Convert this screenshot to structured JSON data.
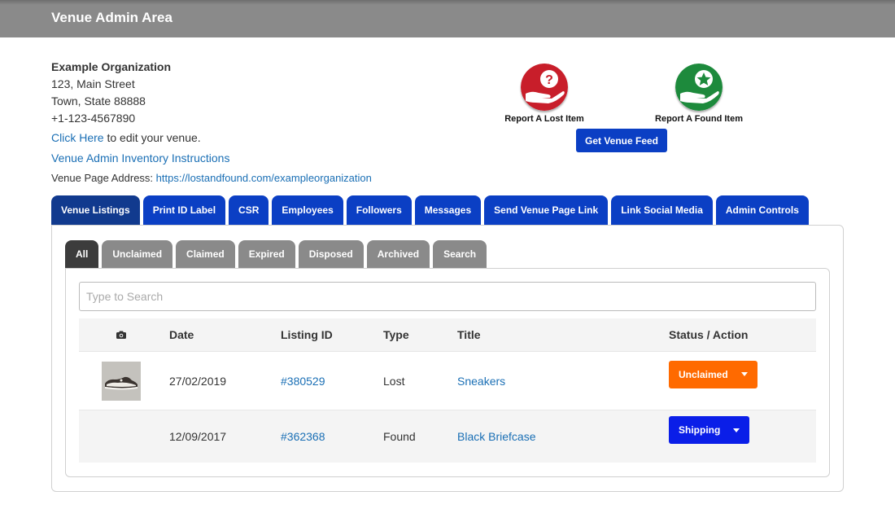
{
  "header": {
    "title": "Venue Admin Area"
  },
  "venue": {
    "name": "Example Organization",
    "address_line1": "123, Main Street",
    "address_line2": "Town, State 88888",
    "phone": "+1-123-4567890",
    "edit_link": "Click Here",
    "edit_suffix": " to edit your venue.",
    "instructions_link": "Venue Admin Inventory Instructions",
    "page_address_label": "Venue Page Address: ",
    "page_address_url": "https://lostandfound.com/exampleorganization"
  },
  "actions": {
    "report_lost": "Report A Lost Item",
    "report_found": "Report A Found Item",
    "venue_feed": "Get Venue Feed"
  },
  "main_tabs": [
    {
      "label": "Venue Listings",
      "active": true
    },
    {
      "label": "Print ID Label"
    },
    {
      "label": "CSR"
    },
    {
      "label": "Employees"
    },
    {
      "label": "Followers"
    },
    {
      "label": "Messages"
    },
    {
      "label": "Send Venue Page Link"
    },
    {
      "label": "Link Social Media"
    },
    {
      "label": "Admin Controls"
    }
  ],
  "sub_tabs": [
    {
      "label": "All",
      "active": true
    },
    {
      "label": "Unclaimed"
    },
    {
      "label": "Claimed"
    },
    {
      "label": "Expired"
    },
    {
      "label": "Disposed"
    },
    {
      "label": "Archived"
    },
    {
      "label": "Search"
    }
  ],
  "search": {
    "placeholder": "Type to Search",
    "value": ""
  },
  "table": {
    "columns": {
      "photo": "camera-icon",
      "date": "Date",
      "listing_id": "Listing ID",
      "type": "Type",
      "title": "Title",
      "status": "Status / Action"
    },
    "rows": [
      {
        "date": "27/02/2019",
        "listing_id": "#380529",
        "type": "Lost",
        "title": "Sneakers",
        "status": "Unclaimed",
        "status_color": "#ff6a00",
        "has_photo": true
      },
      {
        "date": "12/09/2017",
        "listing_id": "#362368",
        "type": "Found",
        "title": "Black Briefcase",
        "status": "Shipping",
        "status_color": "#0a1ee8",
        "has_photo": false
      }
    ]
  },
  "colors": {
    "tab_blue": "#0b3fc4",
    "tab_active": "#113a8e",
    "link": "#1a6fb5",
    "lost_red": "#c81e2a",
    "found_green": "#1d8a3c"
  }
}
